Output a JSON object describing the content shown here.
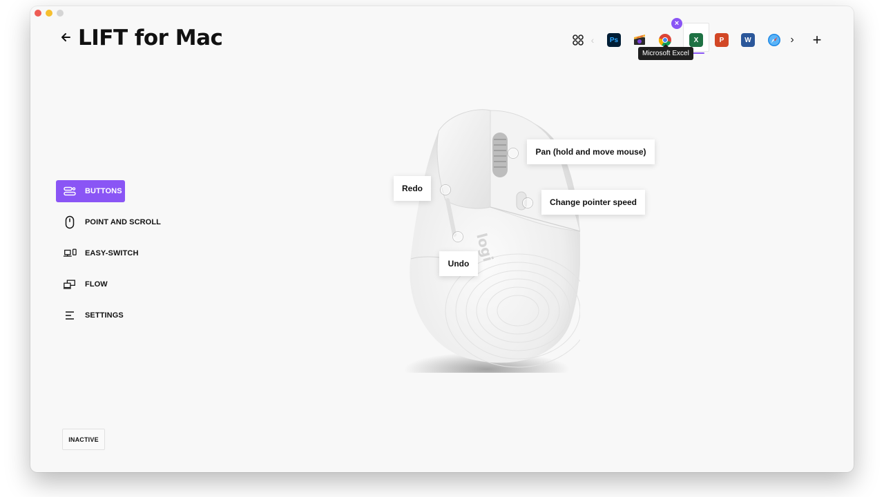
{
  "header": {
    "title": "LIFT for Mac"
  },
  "appbar": {
    "apps": [
      {
        "name": "all-apps"
      },
      {
        "name": "photoshop",
        "label": "Ps",
        "color": "#001e36",
        "text": "#31a8ff"
      },
      {
        "name": "final-cut",
        "label": "",
        "color": "#f2b131"
      },
      {
        "name": "chrome",
        "label": "",
        "color": "#db4437"
      },
      {
        "name": "excel",
        "label": "X",
        "color": "#1f7244"
      },
      {
        "name": "powerpoint",
        "label": "P",
        "color": "#d24726"
      },
      {
        "name": "word",
        "label": "W",
        "color": "#2b579a"
      },
      {
        "name": "safari",
        "label": "",
        "color": "#1e88e5"
      }
    ],
    "tooltip": "Microsoft Excel",
    "accent": "#8a55f5"
  },
  "nav": {
    "items": [
      {
        "label": "BUTTONS",
        "icon": "buttons-icon",
        "active": true
      },
      {
        "label": "POINT AND SCROLL",
        "icon": "mouse-icon",
        "active": false
      },
      {
        "label": "EASY-SWITCH",
        "icon": "easy-switch-icon",
        "active": false
      },
      {
        "label": "FLOW",
        "icon": "flow-icon",
        "active": false
      },
      {
        "label": "SETTINGS",
        "icon": "settings-icon",
        "active": false
      }
    ]
  },
  "status": {
    "inactive": "INACTIVE"
  },
  "callouts": {
    "pan": "Pan (hold and move mouse)",
    "redo": "Redo",
    "pointer_speed": "Change pointer speed",
    "undo": "Undo"
  },
  "device": {
    "logo": "logi"
  }
}
